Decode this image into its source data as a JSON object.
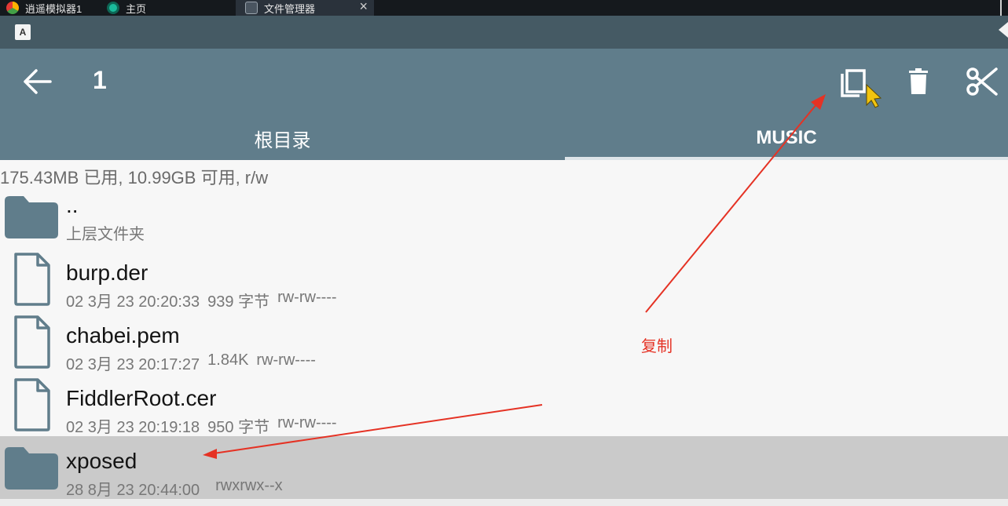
{
  "host_tabs": [
    {
      "label": "逍遥模拟器1",
      "icon": "emulator-logo-icon"
    },
    {
      "label": "主页",
      "icon": "home-app-icon"
    },
    {
      "label": "文件管理器",
      "icon": "file-manager-app-icon",
      "close": "×"
    }
  ],
  "status_bar": {
    "app_icon_letter": "A"
  },
  "toolbar": {
    "title": "1",
    "actions": [
      "copy-icon",
      "delete-icon",
      "cut-icon"
    ]
  },
  "tabs": [
    {
      "label": "根目录"
    },
    {
      "label": "MUSIC"
    }
  ],
  "storage_info": "175.43MB 已用, 10.99GB 可用, r/w",
  "files": [
    {
      "name": "..",
      "meta": [
        "上层文件夹"
      ],
      "type": "folder"
    },
    {
      "name": "burp.der",
      "meta": [
        "02 3月 23 20:20:33",
        "939 字节",
        "rw-rw----"
      ],
      "type": "file"
    },
    {
      "name": "chabei.pem",
      "meta": [
        "02 3月 23 20:17:27",
        "1.84K",
        "rw-rw----"
      ],
      "type": "file"
    },
    {
      "name": "FiddlerRoot.cer",
      "meta": [
        "02 3月 23 20:19:18",
        "950 字节",
        "rw-rw----"
      ],
      "type": "file"
    },
    {
      "name": "xposed",
      "meta": [
        "28 8月 23 20:44:00",
        "rwxrwx--x"
      ],
      "type": "folder",
      "selected": true
    }
  ],
  "annotation": {
    "label": "复制",
    "color": "#e53224"
  },
  "colors": {
    "toolbar": "#607d8b",
    "status_bar": "#455a64",
    "folder_icon": "#607d8b",
    "selected_row": "#cacaca"
  }
}
